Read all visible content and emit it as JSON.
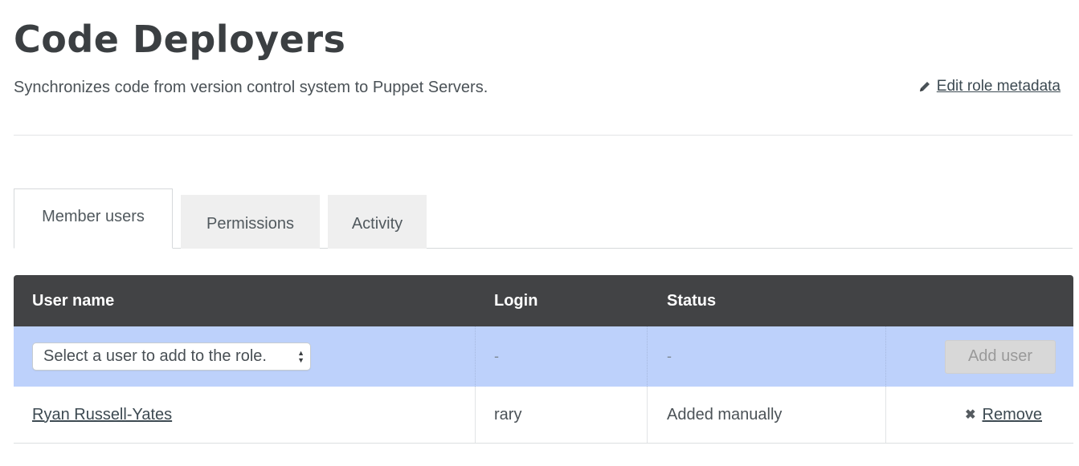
{
  "page": {
    "title": "Code Deployers",
    "description": "Synchronizes code from version control system to Puppet Servers.",
    "edit_link": "Edit role metadata"
  },
  "tabs": [
    {
      "label": "Member users",
      "active": true
    },
    {
      "label": "Permissions",
      "active": false
    },
    {
      "label": "Activity",
      "active": false
    }
  ],
  "table": {
    "headers": [
      "User name",
      "Login",
      "Status",
      ""
    ],
    "add_row": {
      "select_placeholder": "Select a user to add to the role.",
      "login": "-",
      "status": "-",
      "add_button": "Add user"
    },
    "rows": [
      {
        "user_name": "Ryan Russell-Yates",
        "login": "rary",
        "status": "Added manually",
        "action": "Remove"
      }
    ]
  },
  "icons": {
    "edit": "pencil-icon",
    "select": "select-arrows-icon",
    "remove": "close-icon"
  },
  "colors": {
    "header_bg": "#424345",
    "add_row_bg": "#bdd1fb",
    "disabled_button_bg": "#d8d8d8"
  }
}
